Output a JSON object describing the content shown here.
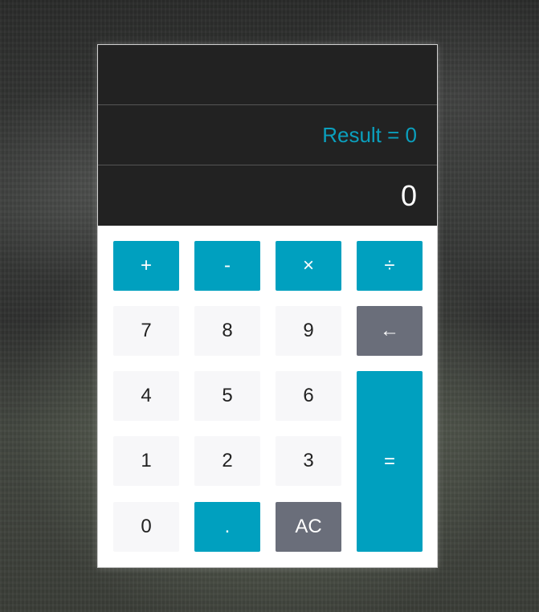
{
  "display": {
    "expression": "",
    "result": "Result = 0",
    "current": "0"
  },
  "keys": {
    "add": "+",
    "subtract": "-",
    "multiply": "×",
    "divide": "÷",
    "seven": "7",
    "eight": "8",
    "nine": "9",
    "backspace": "←",
    "four": "4",
    "five": "5",
    "six": "6",
    "equals": "=",
    "one": "1",
    "two": "2",
    "three": "3",
    "zero": "0",
    "decimal": ".",
    "clear": "AC"
  },
  "colors": {
    "accent": "#00a0bf",
    "screen_background": "#222222",
    "result_text": "#0b9fbd",
    "number_key": "#f7f7f9",
    "dark_key": "#6a6e7a"
  }
}
